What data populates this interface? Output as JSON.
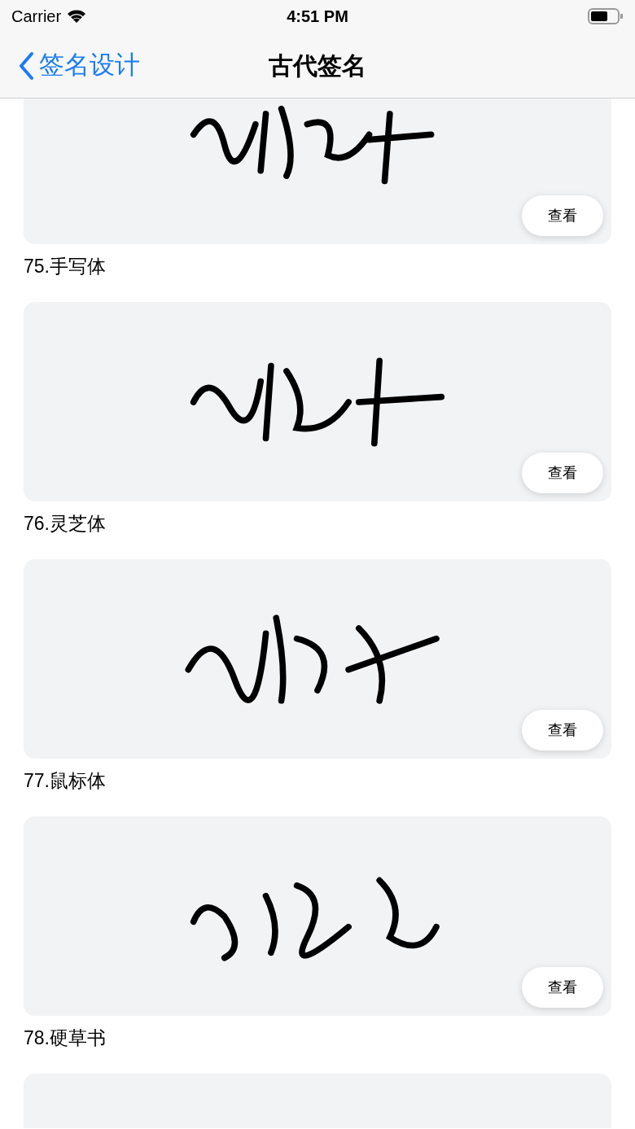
{
  "status_bar": {
    "carrier": "Carrier",
    "time": "4:51 PM"
  },
  "nav_bar": {
    "back_label": "签名设计",
    "title": "古代签名"
  },
  "items": [
    {
      "kind": "signature",
      "button": "查看",
      "caption": "75.手写体"
    },
    {
      "kind": "signature",
      "button": "查看",
      "caption": "76.灵芝体"
    },
    {
      "kind": "signature",
      "button": "查看",
      "caption": "77.鼠标体"
    },
    {
      "kind": "signature",
      "button": "查看",
      "caption": "78.硬草书"
    },
    {
      "kind": "signature"
    }
  ]
}
